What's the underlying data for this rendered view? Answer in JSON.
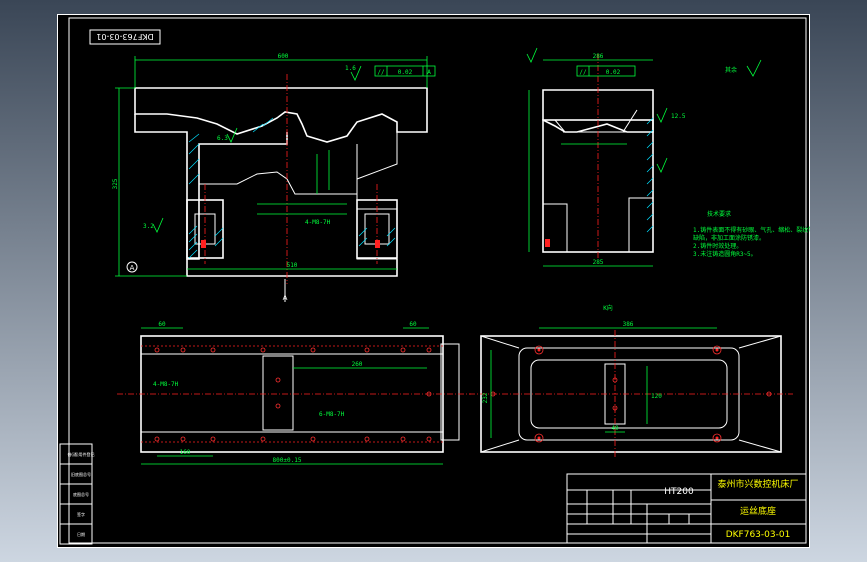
{
  "drawing": {
    "drawing_number_rotated": "DKF763-03-01",
    "material": "HT200",
    "company": "泰州市兴数控机床厂",
    "part_name": "运丝底座",
    "drawing_number": "DKF763-03-01",
    "tech_requirements_title": "技术要求",
    "tech_requirements": [
      "1.铸件表面不得有砂眼、气孔、缩松、裂纹等",
      "  缺陷，非加工面涂防锈漆。",
      "2.铸件时效处理。",
      "3.未注铸造圆角R3~5。"
    ],
    "roughness_other": "其余",
    "section_label": "A",
    "view_label": "K向",
    "dims": {
      "top_width": "600",
      "side_top": "286",
      "height": "325",
      "base_width": "510",
      "bottom_length": "800±0.15",
      "plan_width": "386",
      "plan_height": "232",
      "hole_pitch": "160",
      "plan_dim_260": "260",
      "plan_dim_120": "120",
      "plan_dim_40": "40",
      "left_60": "60",
      "right_60": "60",
      "holes_note": "4-M8-7H",
      "holes_note2": "6-M8-7H",
      "side_width": "285"
    },
    "gdt": {
      "parallel_1": "0.02",
      "parallel_2": "0.02",
      "datum": "A"
    },
    "roughness": {
      "ra1": "1.6",
      "ra2": "3.2",
      "ra3": "6.3",
      "ra4": "12.5"
    },
    "sidebar_labels": [
      "借(通)用件登记",
      "旧底图总号",
      "底图总号",
      "签字",
      "日期"
    ]
  },
  "colors": {
    "background": "#000000",
    "outline": "#ffffff",
    "dimension": "#00ff3c",
    "centerline": "#ff2020",
    "title_text": "#ffff00"
  }
}
